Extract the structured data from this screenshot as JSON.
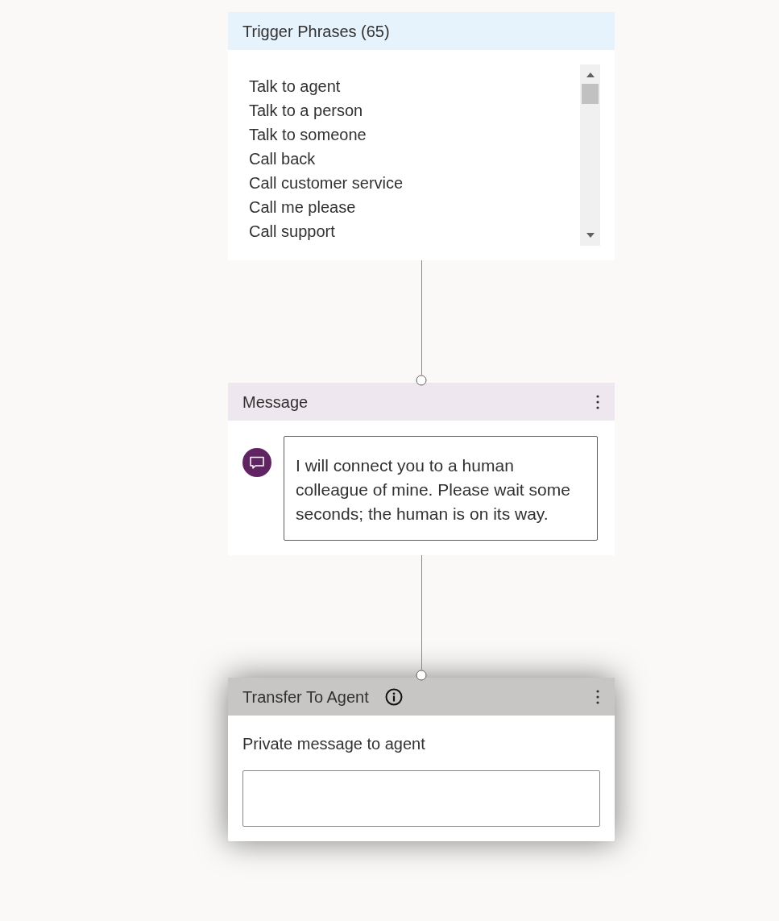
{
  "nodes": [
    {
      "kind": "trigger",
      "title": "Trigger Phrases (65)",
      "selected": false,
      "phrases": [
        "Talk to agent",
        "Talk to a person",
        "Talk to someone",
        "Call back",
        "Call customer service",
        "Call me please",
        "Call support"
      ]
    },
    {
      "kind": "message",
      "title": "Message",
      "selected": false,
      "text": "I will connect you to a human colleague of mine. Please wait some seconds; the human is on its way."
    },
    {
      "kind": "transfer",
      "title": "Transfer To Agent",
      "selected": true,
      "field_label": "Private message to agent"
    }
  ]
}
